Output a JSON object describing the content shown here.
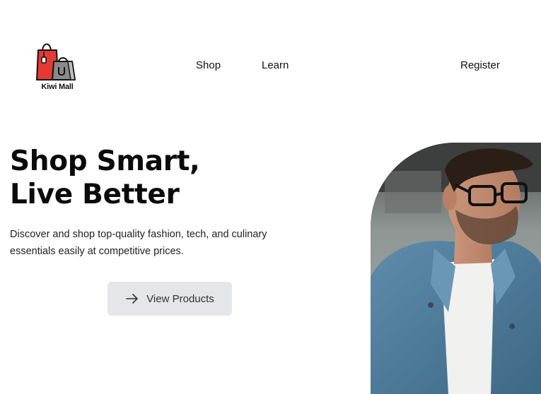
{
  "header": {
    "logo_text": "Kiwi Mall",
    "nav": {
      "shop": "Shop",
      "learn": "Learn",
      "register": "Register"
    }
  },
  "hero": {
    "title": "Shop Smart, Live Better",
    "description": "Discover and shop top-quality fashion, tech, and culinary essentials easily at competitive prices.",
    "cta_label": "View Products"
  },
  "colors": {
    "bag_red": "#e53935",
    "bag_gray": "#8a8a8a",
    "button_bg": "#e5e6ea"
  },
  "icons": {
    "logo": "shopping-bags-icon",
    "cta": "arrow-right-icon"
  }
}
